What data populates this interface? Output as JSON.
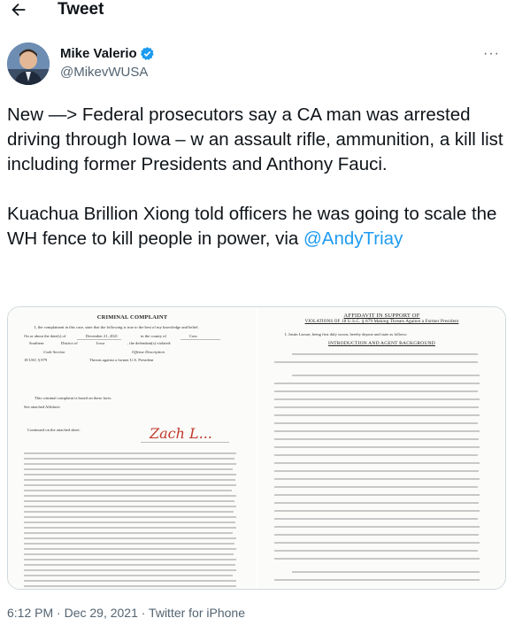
{
  "header": {
    "title": "Tweet"
  },
  "author": {
    "name": "Mike Valerio",
    "handle": "@MikevWUSA"
  },
  "tweet": {
    "line1": "New —> Federal prosecutors say a CA man was arrested driving through Iowa – w an assault rifle, ammunition, a kill list including former Presidents and Anthony Fauci.",
    "line2": "Kuachua Brillion Xiong told officers he was going to scale the WH fence to kill people in power, via ",
    "mention": "@AndyTriay"
  },
  "media": {
    "left_doc": {
      "title": "CRIMINAL COMPLAINT",
      "intro": "I, the complainant in this case, state that the following is true to the best of my knowledge and belief.",
      "date_label": "On or about the date(s) of",
      "date_value": "December 21, 2021",
      "county_label": "in the county of",
      "county_value": "Cass",
      "district_value": "Southern",
      "district_label": "District of",
      "state_value": "Iowa",
      "defendant_label": ", the defendant(s) violated:",
      "code_header": "Code Section",
      "offense_header": "Offense Description",
      "code_value": "18 USC § 879",
      "offense_value": "Threats against a former U.S. President",
      "based_on": "This criminal complaint is based on these facts:",
      "see_affidavit": "See attached Affidavit",
      "continued": "Continued on the attached sheet.",
      "signature": "Zach L..."
    },
    "right_doc": {
      "title1": "AFFIDAVIT IN SUPPORT OF",
      "title2": "VIOLATIONS OF 18 U.S.C. § 879 Making Threats Against a Former President",
      "intro": "I, Justin Larson, being first duly sworn, hereby depose and state as follows:",
      "section": "INTRODUCTION AND AGENT BACKGROUND"
    }
  },
  "meta": {
    "timestamp": "6:12 PM · Dec 29, 2021 · Twitter for iPhone"
  },
  "colors": {
    "link": "#1d9bf0",
    "secondary": "#536471",
    "verified": "#1d9bf0"
  }
}
